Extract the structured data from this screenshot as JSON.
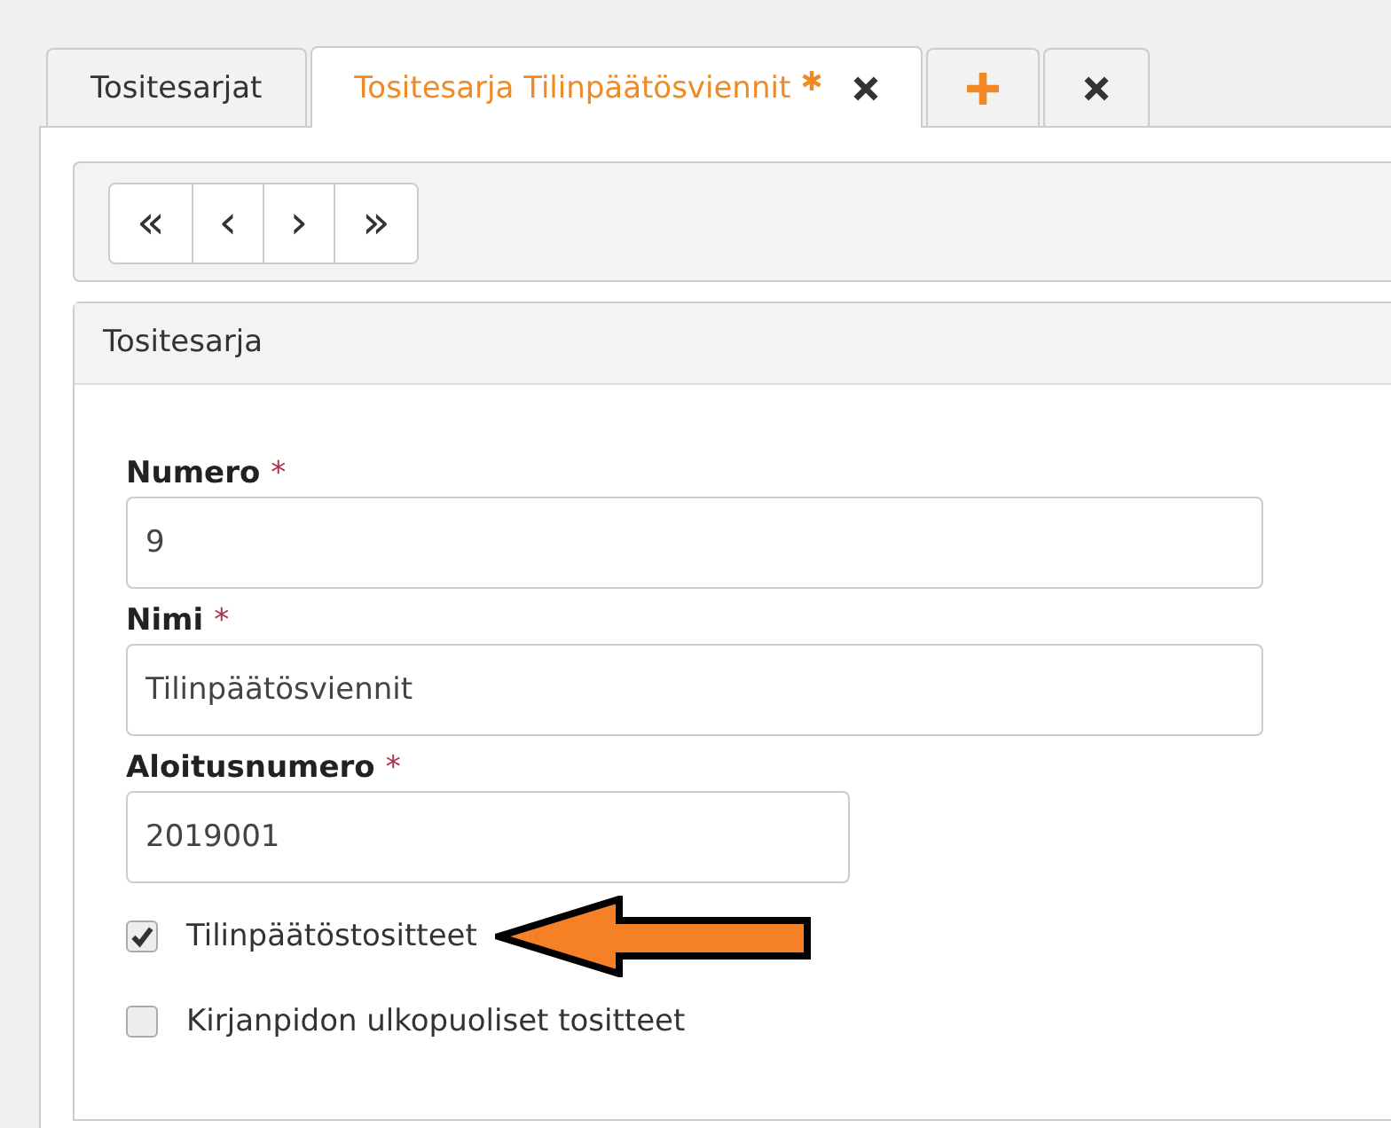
{
  "tabs": [
    {
      "kind": "tab",
      "label": "Tositesarjat",
      "selected": false,
      "modified": false,
      "closable": false
    },
    {
      "kind": "tab",
      "label": "Tositesarja Tilinpäätösviennit",
      "selected": true,
      "modified": true,
      "closable": true
    },
    {
      "kind": "add",
      "selected": false
    },
    {
      "kind": "close",
      "selected": false
    }
  ],
  "pager": [
    {
      "label": "«"
    },
    {
      "label": "‹"
    },
    {
      "label": "›"
    },
    {
      "label": "»"
    }
  ],
  "section": {
    "title": "Tositesarja"
  },
  "fields": [
    {
      "label": "Numero",
      "required_mark": "*",
      "value": "9",
      "wide": true
    },
    {
      "label": "Nimi",
      "required_mark": "*",
      "value": "Tilinpäätösviennit",
      "wide": true
    },
    {
      "label": "Aloitusnumero",
      "required_mark": "*",
      "value": "2019001",
      "wide": false
    }
  ],
  "checkboxes": [
    {
      "label": "Tilinpäätöstositteet",
      "checked": true
    },
    {
      "label": "Kirjanpidon ulkopuoliset tositteet",
      "checked": false
    }
  ]
}
